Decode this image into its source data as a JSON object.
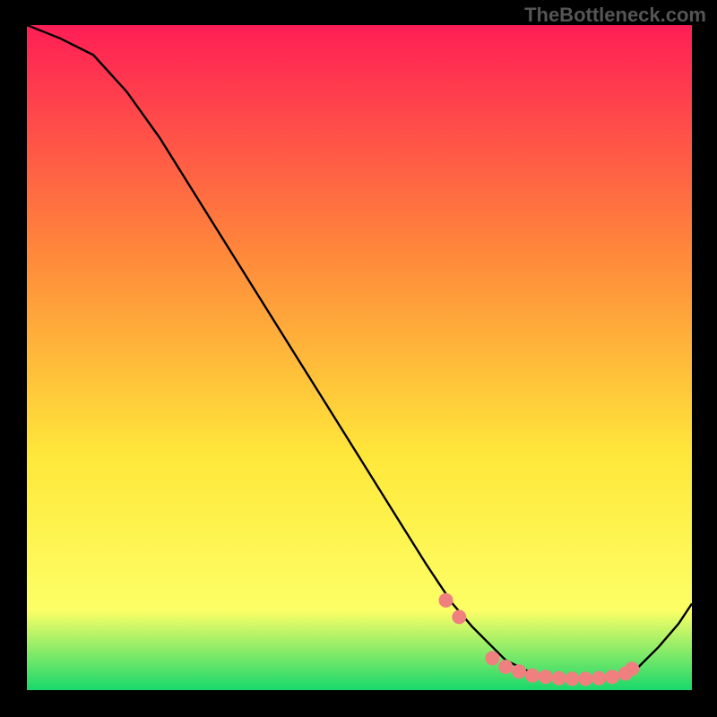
{
  "watermark": "TheBottleneck.com",
  "chart_data": {
    "type": "line",
    "title": "",
    "xlabel": "",
    "ylabel": "",
    "xlim": [
      0,
      100
    ],
    "ylim": [
      0,
      100
    ],
    "background_gradient": {
      "top": "#ff1e55",
      "mid_upper": "#ff8a3a",
      "mid": "#ffe83a",
      "mid_lower": "#fdff66",
      "bottom": "#18d86b"
    },
    "curve": {
      "x": [
        0,
        5,
        10,
        15,
        20,
        25,
        30,
        35,
        40,
        45,
        50,
        55,
        60,
        62,
        64,
        67,
        70,
        72,
        75,
        78,
        80,
        82,
        85,
        88,
        90,
        92,
        95,
        98,
        100
      ],
      "y": [
        100,
        98,
        95.5,
        90,
        83,
        75,
        67,
        59,
        51,
        43,
        35,
        27,
        19,
        16,
        13,
        9.5,
        6.5,
        4.5,
        3.0,
        2.0,
        1.7,
        1.5,
        1.5,
        1.7,
        2.3,
        3.5,
        6.5,
        10,
        13
      ]
    },
    "markers": {
      "x": [
        63,
        65,
        70,
        72,
        74,
        76,
        78,
        80,
        82,
        84,
        86,
        88,
        90,
        91
      ],
      "y": [
        13.5,
        11,
        4.8,
        3.5,
        2.8,
        2.2,
        2.0,
        1.8,
        1.7,
        1.7,
        1.8,
        2.0,
        2.5,
        3.2
      ],
      "color": "#f08080"
    }
  }
}
